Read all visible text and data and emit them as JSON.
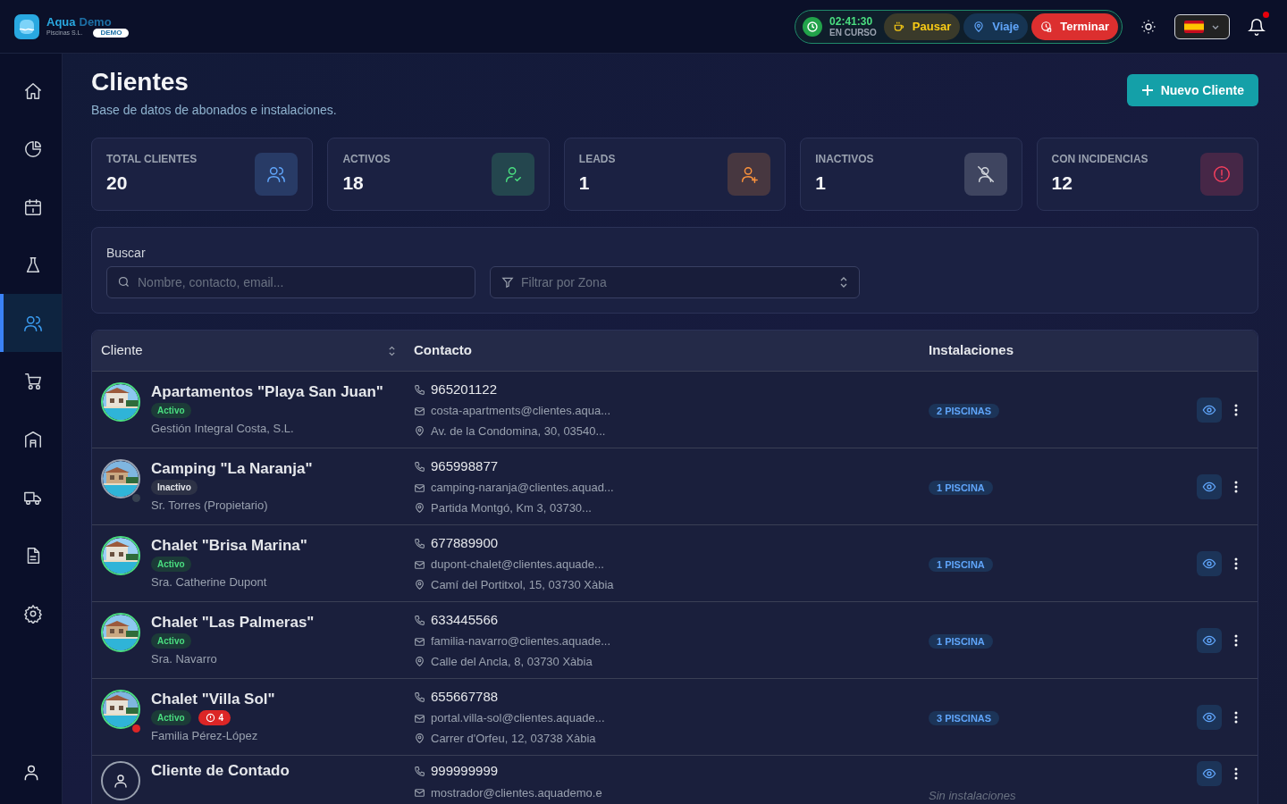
{
  "brand": {
    "name_first": "Aqua",
    "name_second": "Demo",
    "subtitle": "Piscinas S.L.",
    "badge": "DEMO"
  },
  "timer": {
    "time": "02:41:30",
    "status": "EN CURSO",
    "buttons": [
      {
        "kind": "pause",
        "label": "Pausar"
      },
      {
        "kind": "trip",
        "label": "Viaje"
      },
      {
        "kind": "stop",
        "label": "Terminar"
      }
    ]
  },
  "notifications": {
    "unread": true
  },
  "sidebar": {
    "items": [
      {
        "selected": false
      },
      {
        "selected": false
      },
      {
        "selected": false
      },
      {
        "selected": false
      },
      {
        "selected": true
      },
      {
        "selected": false
      },
      {
        "selected": false
      },
      {
        "selected": false
      },
      {
        "selected": false
      },
      {
        "selected": false
      }
    ]
  },
  "page": {
    "title": "Clientes",
    "subtitle": "Base de datos de abonados e instalaciones.",
    "new_button": "Nuevo Cliente"
  },
  "stats": [
    {
      "label": "TOTAL CLIENTES",
      "value": "20",
      "color": "#60a5fa"
    },
    {
      "label": "ACTIVOS",
      "value": "18",
      "color": "#4ade80"
    },
    {
      "label": "LEADS",
      "value": "1",
      "color": "#fb923c"
    },
    {
      "label": "INACTIVOS",
      "value": "1",
      "color": "#d1d5db"
    },
    {
      "label": "CON INCIDENCIAS",
      "value": "12",
      "color": "#f43f5e"
    }
  ],
  "search": {
    "label": "Buscar",
    "placeholder": "Nombre, contacto, email...",
    "zone_placeholder": "Filtrar por Zona"
  },
  "table": {
    "columns": [
      "Cliente",
      "Contacto",
      "Instalaciones"
    ],
    "rows": [
      {
        "kind": "picture",
        "name": "Apartamentos \"Playa San Juan\"",
        "status": {
          "label": "Activo",
          "active": true
        },
        "contact_person": "Gestión Integral Costa, S.L.",
        "phone": "965201122",
        "email": "costa-apartments@clientes.aqua...",
        "address": "Av. de la Condomina, 30, 03540...",
        "installations": {
          "kind": "badge",
          "label": "2 PISCINAS"
        }
      },
      {
        "kind": "picture",
        "name": "Camping \"La Naranja\"",
        "status": {
          "label": "Inactivo",
          "active": false
        },
        "color": "#374151",
        "contact_person": "Sr. Torres (Propietario)",
        "phone": "965998877",
        "email": "camping-naranja@clientes.aquad...",
        "address": "Partida Montgó, Km 3, 03730...",
        "installations": {
          "kind": "badge",
          "label": "1 PISCINA"
        }
      },
      {
        "kind": "picture",
        "name": "Chalet \"Brisa Marina\"",
        "status": {
          "label": "Activo",
          "active": true
        },
        "contact_person": "Sra. Catherine Dupont",
        "phone": "677889900",
        "email": "dupont-chalet@clientes.aquade...",
        "address": "Camí del Portitxol, 15, 03730 Xàbia",
        "installations": {
          "kind": "badge",
          "label": "1 PISCINA"
        }
      },
      {
        "kind": "picture",
        "name": "Chalet \"Las Palmeras\"",
        "status": {
          "label": "Activo",
          "active": true
        },
        "contact_person": "Sra. Navarro",
        "phone": "633445566",
        "email": "familia-navarro@clientes.aquade...",
        "address": "Calle del Ancla, 8, 03730 Xàbia",
        "installations": {
          "kind": "badge",
          "label": "1 PISCINA"
        }
      },
      {
        "kind": "picture",
        "name": "Chalet \"Villa Sol\"",
        "status": {
          "label": "Activo",
          "active": true
        },
        "incidents": "4",
        "color": "#dc2626",
        "contact_person": "Familia Pérez-López",
        "phone": "655667788",
        "email": "portal.villa-sol@clientes.aquade...",
        "address": "Carrer d'Orfeu, 12, 03738 Xàbia",
        "installations": {
          "kind": "badge",
          "label": "3 PISCINAS"
        }
      },
      {
        "kind": "placeholder",
        "name": "Cliente de Contado",
        "phone": "999999999",
        "email": "mostrador@clientes.aquademo.e",
        "installations": {
          "kind": "none",
          "label": "Sin instalaciones"
        }
      }
    ]
  }
}
